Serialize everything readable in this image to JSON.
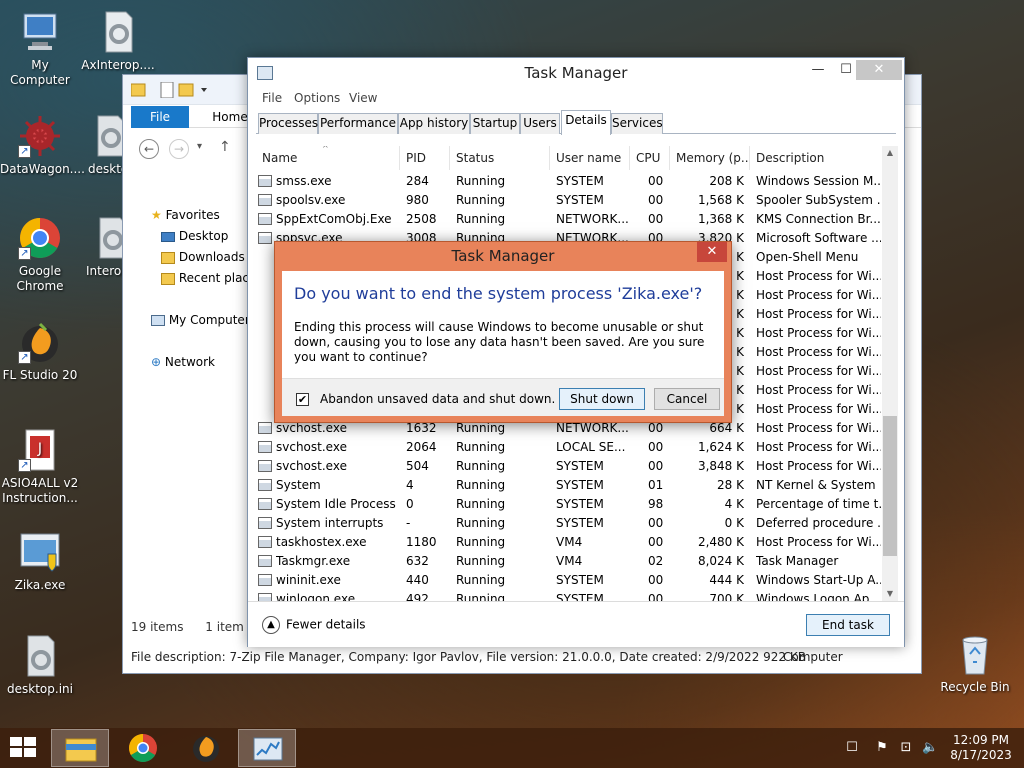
{
  "desktop": {
    "icons": [
      {
        "label": "My Computer",
        "icon": "computer-icon"
      },
      {
        "label": "AxInterop....",
        "icon": "dll-gear-icon"
      },
      {
        "label": "DataWagon....",
        "icon": "virus-app-icon"
      },
      {
        "label": "deskto",
        "icon": "gear-file-icon"
      },
      {
        "label": "Google Chrome",
        "icon": "chrome-icon"
      },
      {
        "label": "Interop",
        "icon": "gear-file-icon"
      },
      {
        "label": "FL Studio 20",
        "icon": "fl-studio-icon"
      },
      {
        "label": "ASIO4ALL v2 Instruction...",
        "icon": "pdf-icon"
      },
      {
        "label": "Zika.exe",
        "icon": "exe-shield-icon"
      },
      {
        "label": "desktop.ini",
        "icon": "gear-file-icon"
      },
      {
        "label": "Recycle Bin",
        "icon": "recycle-bin-icon"
      }
    ]
  },
  "explorer": {
    "file_tab": "File",
    "home_tab": "Home",
    "sidebar": {
      "favorites": "Favorites",
      "desktop": "Desktop",
      "downloads": "Downloads",
      "recent": "Recent place",
      "my_computer": "My Computer",
      "network": "Network"
    },
    "status_items": "19 items",
    "status_selected": "1 item",
    "description": "File description: 7-Zip File Manager, Company: Igor Pavlov, File version: 21.0.0.0, Date created: 2/9/2022 922 KB",
    "status_right": "Computer"
  },
  "task_manager": {
    "title": "Task Manager",
    "menu": [
      "File",
      "Options",
      "View"
    ],
    "tabs": [
      "Processes",
      "Performance",
      "App history",
      "Startup",
      "Users",
      "Details",
      "Services"
    ],
    "active_tab": "Details",
    "columns": [
      "Name",
      "PID",
      "Status",
      "User name",
      "CPU",
      "Memory (p...",
      "Description"
    ],
    "rows": [
      {
        "name": "smss.exe",
        "pid": "284",
        "status": "Running",
        "user": "SYSTEM",
        "cpu": "00",
        "mem": "208 K",
        "desc": "Windows Session M..."
      },
      {
        "name": "spoolsv.exe",
        "pid": "980",
        "status": "Running",
        "user": "SYSTEM",
        "cpu": "00",
        "mem": "1,568 K",
        "desc": "Spooler SubSystem ..."
      },
      {
        "name": "SppExtComObj.Exe",
        "pid": "2508",
        "status": "Running",
        "user": "NETWORK...",
        "cpu": "00",
        "mem": "1,368 K",
        "desc": "KMS Connection Br..."
      },
      {
        "name": "sppsvc.exe",
        "pid": "3008",
        "status": "Running",
        "user": "NETWORK...",
        "cpu": "00",
        "mem": "3,820 K",
        "desc": "Microsoft Software ..."
      },
      {
        "name": "",
        "pid": "",
        "status": "",
        "user": "",
        "cpu": "",
        "mem": "K",
        "desc": "Open-Shell Menu"
      },
      {
        "name": "",
        "pid": "",
        "status": "",
        "user": "",
        "cpu": "",
        "mem": "K",
        "desc": "Host Process for Wi..."
      },
      {
        "name": "",
        "pid": "",
        "status": "",
        "user": "",
        "cpu": "",
        "mem": "K",
        "desc": "Host Process for Wi..."
      },
      {
        "name": "",
        "pid": "",
        "status": "",
        "user": "",
        "cpu": "",
        "mem": "K",
        "desc": "Host Process for Wi..."
      },
      {
        "name": "",
        "pid": "",
        "status": "",
        "user": "",
        "cpu": "",
        "mem": "K",
        "desc": "Host Process for Wi..."
      },
      {
        "name": "",
        "pid": "",
        "status": "",
        "user": "",
        "cpu": "",
        "mem": "K",
        "desc": "Host Process for Wi..."
      },
      {
        "name": "",
        "pid": "",
        "status": "",
        "user": "",
        "cpu": "",
        "mem": "K",
        "desc": "Host Process for Wi..."
      },
      {
        "name": "",
        "pid": "",
        "status": "",
        "user": "",
        "cpu": "",
        "mem": "K",
        "desc": "Host Process for Wi..."
      },
      {
        "name": "",
        "pid": "",
        "status": "",
        "user": "",
        "cpu": "",
        "mem": "K",
        "desc": "Host Process for Wi..."
      },
      {
        "name": "svchost.exe",
        "pid": "1632",
        "status": "Running",
        "user": "NETWORK...",
        "cpu": "00",
        "mem": "664 K",
        "desc": "Host Process for Wi..."
      },
      {
        "name": "svchost.exe",
        "pid": "2064",
        "status": "Running",
        "user": "LOCAL SE...",
        "cpu": "00",
        "mem": "1,624 K",
        "desc": "Host Process for Wi..."
      },
      {
        "name": "svchost.exe",
        "pid": "504",
        "status": "Running",
        "user": "SYSTEM",
        "cpu": "00",
        "mem": "3,848 K",
        "desc": "Host Process for Wi..."
      },
      {
        "name": "System",
        "pid": "4",
        "status": "Running",
        "user": "SYSTEM",
        "cpu": "01",
        "mem": "28 K",
        "desc": "NT Kernel & System"
      },
      {
        "name": "System Idle Process",
        "pid": "0",
        "status": "Running",
        "user": "SYSTEM",
        "cpu": "98",
        "mem": "4 K",
        "desc": "Percentage of time t..."
      },
      {
        "name": "System interrupts",
        "pid": "-",
        "status": "Running",
        "user": "SYSTEM",
        "cpu": "00",
        "mem": "0 K",
        "desc": "Deferred procedure ..."
      },
      {
        "name": "taskhostex.exe",
        "pid": "1180",
        "status": "Running",
        "user": "VM4",
        "cpu": "00",
        "mem": "2,480 K",
        "desc": "Host Process for Wi..."
      },
      {
        "name": "Taskmgr.exe",
        "pid": "632",
        "status": "Running",
        "user": "VM4",
        "cpu": "02",
        "mem": "8,024 K",
        "desc": "Task Manager"
      },
      {
        "name": "wininit.exe",
        "pid": "440",
        "status": "Running",
        "user": "SYSTEM",
        "cpu": "00",
        "mem": "444 K",
        "desc": "Windows Start-Up A..."
      },
      {
        "name": "winlogon.exe",
        "pid": "492",
        "status": "Running",
        "user": "SYSTEM",
        "cpu": "00",
        "mem": "700 K",
        "desc": "Windows Logon Ap..."
      }
    ],
    "fewer_details": "Fewer details",
    "end_task": "End task"
  },
  "dialog": {
    "title": "Task Manager",
    "heading": "Do you want to end the system process 'Zika.exe'?",
    "body": "Ending this process will cause Windows to become unusable or shut down, causing you to lose any data hasn't been saved. Are you sure you want to continue?",
    "checkbox_label": "Abandon unsaved data and shut down.",
    "checkbox_checked": true,
    "shutdown": "Shut down",
    "cancel": "Cancel"
  },
  "taskbar": {
    "time": "12:09 PM",
    "date": "8/17/2023",
    "pinned": [
      "file-explorer-icon",
      "chrome-icon",
      "fl-studio-icon",
      "task-manager-icon"
    ]
  }
}
